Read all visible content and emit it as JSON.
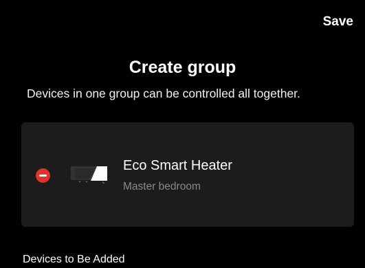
{
  "header": {
    "save_label": "Save",
    "title": "Create group",
    "subtitle": "Devices in one group can be controlled all together."
  },
  "devices": [
    {
      "name": "Eco Smart Heater",
      "room": "Master bedroom",
      "action_icon": "remove-circle-icon",
      "thumbnail_icon": "heater-thumbnail"
    }
  ],
  "sections": {
    "to_add_label": "Devices to Be Added"
  },
  "colors": {
    "background": "#000000",
    "card": "#1c1c1e",
    "remove": "#e0322c",
    "secondary_text": "#8a8a8e"
  }
}
